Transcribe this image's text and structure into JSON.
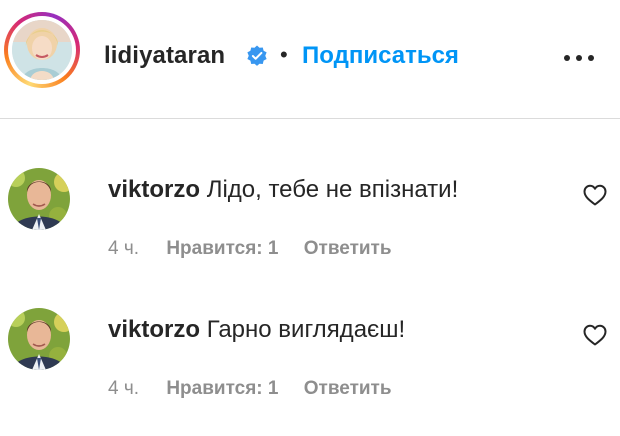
{
  "post": {
    "author": "lidiyataran",
    "verified_icon": "verified-badge-icon",
    "separator": "•",
    "follow_label": "Подписаться",
    "more_icon": "more-options-icon"
  },
  "comments": [
    {
      "username": "viktorzo",
      "text": "Лідо, тебе не впізнати!",
      "time": "4 ч.",
      "likes": "Нравится: 1",
      "reply_label": "Ответить"
    },
    {
      "username": "viktorzo",
      "text": "Гарно виглядаєш!",
      "time": "4 ч.",
      "likes": "Нравится: 1",
      "reply_label": "Ответить"
    }
  ],
  "colors": {
    "accent": "#0095f6",
    "text": "#262626",
    "muted": "#8e8e8e",
    "divider": "#dbdbdb"
  }
}
